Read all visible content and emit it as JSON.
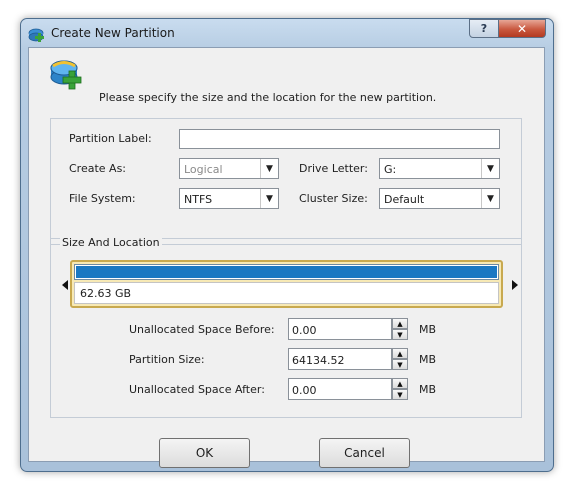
{
  "window": {
    "title": "Create New Partition",
    "help_label": "?",
    "close_label": "✕"
  },
  "intro_text": "Please specify the size and the location for the new partition.",
  "form": {
    "partition_label": {
      "label": "Partition Label:",
      "value": ""
    },
    "create_as": {
      "label": "Create As:",
      "value": "Logical"
    },
    "drive_letter": {
      "label": "Drive Letter:",
      "value": "G:"
    },
    "file_system": {
      "label": "File System:",
      "value": "NTFS"
    },
    "cluster_size": {
      "label": "Cluster Size:",
      "value": "Default"
    }
  },
  "size_location": {
    "legend": "Size And Location",
    "partition_bar_text": "62.63 GB",
    "unallocated_before": {
      "label": "Unallocated Space Before:",
      "value": "0.00",
      "unit": "MB"
    },
    "partition_size": {
      "label": "Partition Size:",
      "value": "64134.52",
      "unit": "MB"
    },
    "unallocated_after": {
      "label": "Unallocated Space After:",
      "value": "0.00",
      "unit": "MB"
    }
  },
  "buttons": {
    "ok": "OK",
    "cancel": "Cancel"
  },
  "icons": {
    "app": "partition-add-icon",
    "dropdown": "chevron-down-icon",
    "spin_up": "spin-up-icon",
    "spin_down": "spin-down-icon"
  },
  "colors": {
    "partition_fill": "#1a78c2",
    "selection_frame": "#c8a94f",
    "close_button": "#c9583f"
  }
}
